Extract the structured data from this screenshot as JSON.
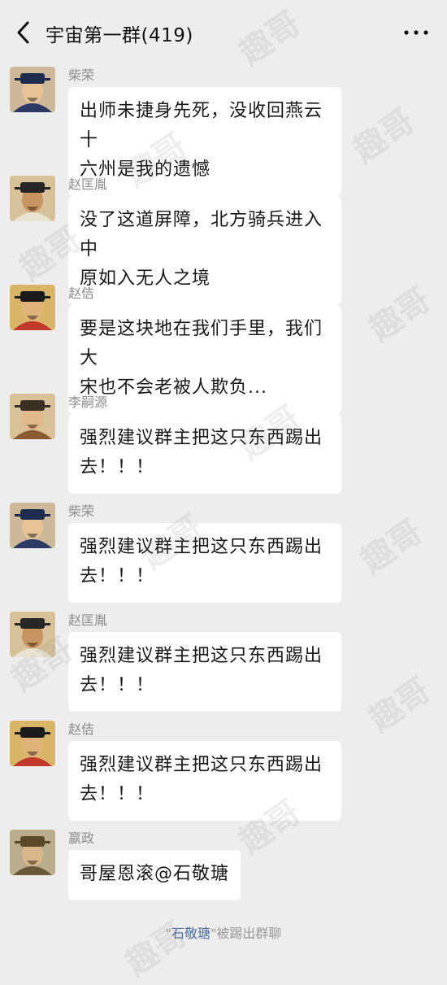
{
  "header": {
    "title": "宇宙第一群(419)",
    "back_icon": "chevron-left-icon",
    "more_icon": "more-dots-icon"
  },
  "messages": [
    {
      "sender": "柴荣",
      "lines": [
        "出师未捷身先死，没收回燕云十",
        "六州是我的遗憾"
      ],
      "avatar": {
        "hat": "#1f2b4f",
        "skin": "#e8c49a",
        "robe": "#2c3a63",
        "bg": "#cdb89a"
      }
    },
    {
      "sender": "赵匡胤",
      "lines": [
        "没了这道屏障，北方骑兵进入中",
        "原如入无人之境"
      ],
      "avatar": {
        "hat": "#262626",
        "skin": "#c89463",
        "robe": "#e8e2d2",
        "bg": "#d6c19a"
      }
    },
    {
      "sender": "赵佶",
      "lines": [
        "要是这块地在我们手里，我们大",
        "宋也不会老被人欺负..."
      ],
      "avatar": {
        "hat": "#1b1b1b",
        "skin": "#e0b37a",
        "robe": "#c0392b",
        "bg": "#d9b56a"
      }
    },
    {
      "sender": "李嗣源",
      "lines": [
        "强烈建议群主把这只东西踢出",
        "去！！！"
      ],
      "avatar": {
        "hat": "#3a2f24",
        "skin": "#e2b98a",
        "robe": "#8a5a32",
        "bg": "#d9c29a"
      }
    },
    {
      "sender": "柴荣",
      "lines": [
        "强烈建议群主把这只东西踢出",
        "去！！！"
      ],
      "avatar": {
        "hat": "#1f2b4f",
        "skin": "#e8c49a",
        "robe": "#2c3a63",
        "bg": "#cdb89a"
      }
    },
    {
      "sender": "赵匡胤",
      "lines": [
        "强烈建议群主把这只东西踢出",
        "去！！！"
      ],
      "avatar": {
        "hat": "#262626",
        "skin": "#c89463",
        "robe": "#e8e2d2",
        "bg": "#d6c19a"
      }
    },
    {
      "sender": "赵佶",
      "lines": [
        "强烈建议群主把这只东西踢出",
        "去！！！"
      ],
      "avatar": {
        "hat": "#1b1b1b",
        "skin": "#e0b37a",
        "robe": "#c0392b",
        "bg": "#d9b56a"
      }
    },
    {
      "sender": "嬴政",
      "lines": [
        "哥屋恩滚@石敬瑭"
      ],
      "avatar": {
        "hat": "#5a4a2a",
        "skin": "#d8b78a",
        "robe": "#6b5a3a",
        "bg": "#b9ad8e"
      }
    }
  ],
  "system_notice": {
    "quote_open": "\"",
    "name": "石敬瑭",
    "quote_close": "\"",
    "text": "被踢出群聊"
  },
  "watermark": "趣哥"
}
